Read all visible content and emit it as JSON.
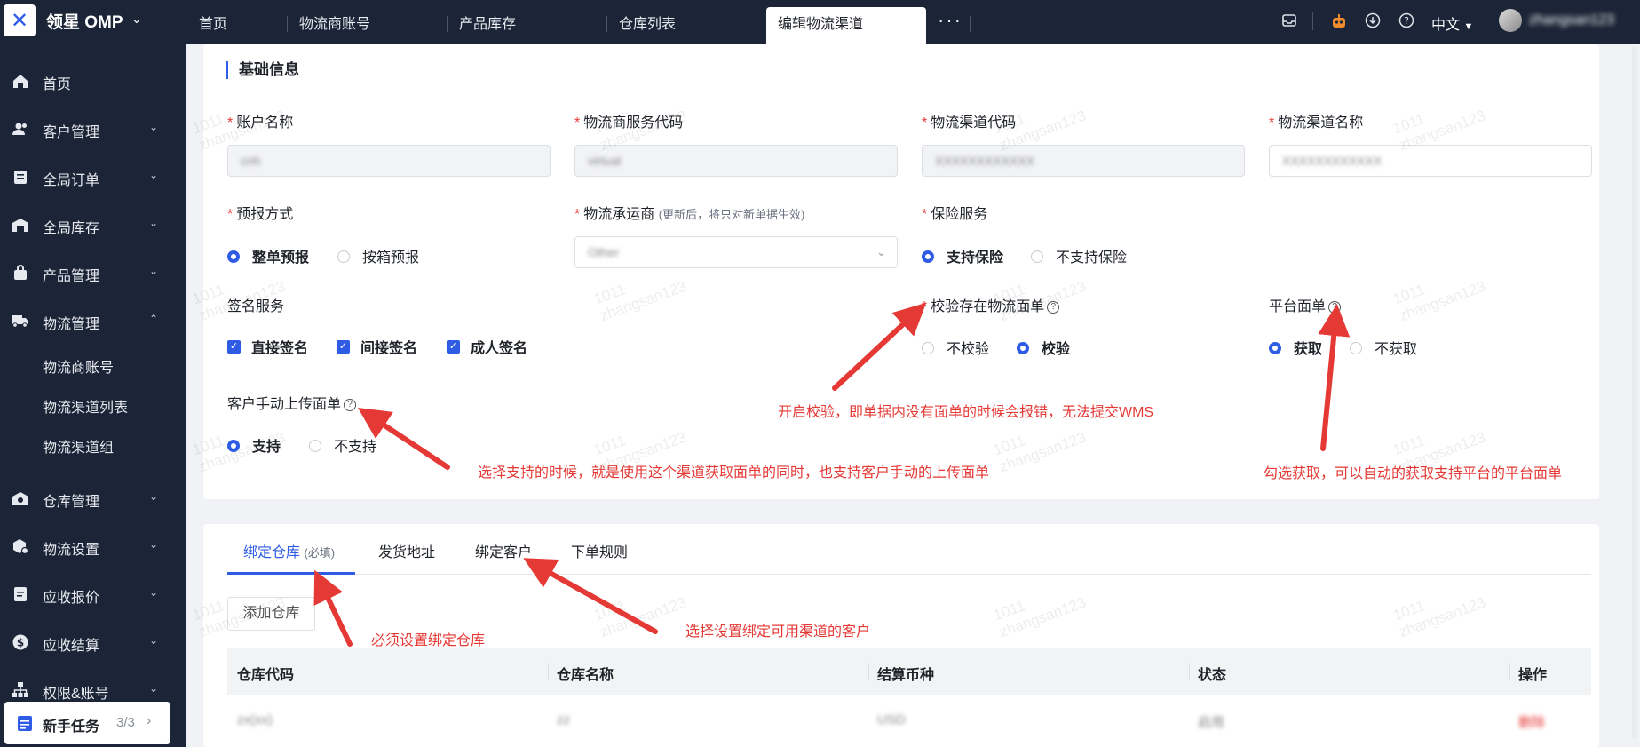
{
  "app": {
    "brand": "领星 OMP",
    "user_name": "zhangsan123"
  },
  "top_tabs": [
    {
      "label": "首页"
    },
    {
      "label": "物流商账号"
    },
    {
      "label": "产品库存"
    },
    {
      "label": "仓库列表"
    },
    {
      "label": "编辑物流渠道",
      "active": true
    }
  ],
  "top_right": {
    "lang": "中文",
    "icons": [
      "inbox-icon",
      "robot-icon",
      "download-icon",
      "help-icon"
    ]
  },
  "sidebar": {
    "items": [
      {
        "label": "首页",
        "icon": "home-icon"
      },
      {
        "label": "客户管理",
        "icon": "users-icon"
      },
      {
        "label": "全局订单",
        "icon": "clipboard-icon"
      },
      {
        "label": "全局库存",
        "icon": "warehouse-icon"
      },
      {
        "label": "产品管理",
        "icon": "bag-icon"
      },
      {
        "label": "物流管理",
        "icon": "truck-icon",
        "expanded": true
      },
      {
        "label": "仓库管理",
        "icon": "warehouse2-icon"
      },
      {
        "label": "物流设置",
        "icon": "package-gear-icon"
      },
      {
        "label": "应收报价",
        "icon": "doc-icon"
      },
      {
        "label": "应收结算",
        "icon": "dollar-icon"
      },
      {
        "label": "权限&账号",
        "icon": "org-icon"
      }
    ],
    "sub_items": [
      "物流商账号",
      "物流渠道列表",
      "物流渠道组"
    ],
    "new_task": {
      "label": "新手任务",
      "count": "3/3"
    }
  },
  "basic_info": {
    "title": "基础信息",
    "fields": {
      "account_name": {
        "label": "账户名称",
        "value": "cnh"
      },
      "service_code": {
        "label": "物流商服务代码",
        "value": "virtual"
      },
      "channel_code": {
        "label": "物流渠道代码",
        "value": "XXXXXXXXXXXX"
      },
      "channel_name": {
        "label": "物流渠道名称",
        "value": "XXXXXXXXXXXX"
      },
      "prereport": {
        "label": "预报方式",
        "options": [
          "整单预报",
          "按箱预报"
        ],
        "selected": "整单预报"
      },
      "carrier": {
        "label": "物流承运商",
        "hint": "(更新后，将只对新单据生效)",
        "value": "Other"
      },
      "insurance": {
        "label": "保险服务",
        "options": [
          "支持保险",
          "不支持保险"
        ],
        "selected": "支持保险"
      },
      "signature": {
        "label": "签名服务",
        "options": [
          "直接签名",
          "间接签名",
          "成人签名"
        ]
      },
      "verify_label": {
        "label": "校验存在物流面单",
        "options": [
          "不校验",
          "校验"
        ],
        "selected": "校验"
      },
      "platform_label": {
        "label": "平台面单",
        "options": [
          "获取",
          "不获取"
        ],
        "selected": "获取"
      },
      "manual_upload": {
        "label": "客户手动上传面单",
        "options": [
          "支持",
          "不支持"
        ],
        "selected": "支持"
      }
    }
  },
  "annotations": {
    "verify": "开启校验，即单据内没有面单的时候会报错，无法提交WMS",
    "manual": "选择支持的时候，就是使用这个渠道获取面单的同时，也支持客户手动的上传面单",
    "platform": "勾选获取，可以自动的获取支持平台的平台面单",
    "warehouse": "必须设置绑定仓库",
    "customer": "选择设置绑定可用渠道的客户"
  },
  "bind_tabs": [
    {
      "label": "绑定仓库",
      "hint": "(必填)",
      "active": true
    },
    {
      "label": "发货地址"
    },
    {
      "label": "绑定客户"
    },
    {
      "label": "下单规则"
    }
  ],
  "add_button": "添加仓库",
  "table": {
    "columns": [
      "仓库代码",
      "仓库名称",
      "结算币种",
      "状态",
      "操作"
    ],
    "rows": [
      [
        "zx(xx)",
        "zz",
        "USD",
        "启用",
        "删除"
      ]
    ]
  },
  "watermark": {
    "line1": "1011",
    "line2": "zhangsan123"
  },
  "colors": {
    "accent": "#2f5ce5",
    "annotation": "#e53935",
    "nav_bg": "#1c2537"
  }
}
